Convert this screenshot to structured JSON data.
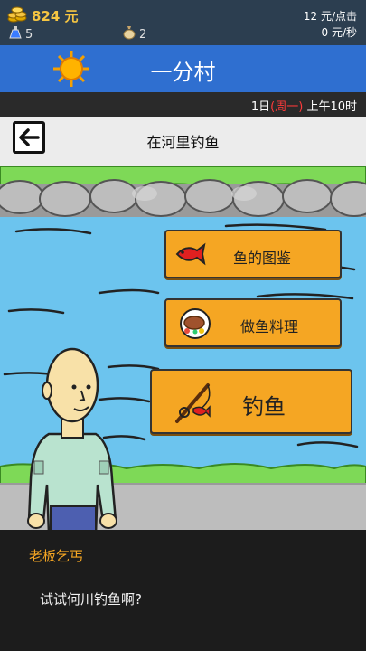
{
  "status": {
    "gold": "824 元",
    "potions": "5",
    "bags": "2",
    "per_click": "12 元/点击",
    "per_second": "0 元/秒"
  },
  "header": {
    "title": "一分村",
    "weather_icon": "sun-icon"
  },
  "date": {
    "day": "1日",
    "weekday": "(周一)",
    "time": "上午10时"
  },
  "scene": {
    "title": "在河里钓鱼",
    "back_icon": "back-arrow-icon"
  },
  "actions": {
    "fish_guide": "鱼的图鉴",
    "cook_fish": "做鱼料理",
    "go_fishing": "钓鱼"
  },
  "dialog": {
    "speaker": "老板乞丐",
    "text": "试试何川钓鱼啊?"
  },
  "colors": {
    "title_bar": "#2f6fd0",
    "button": "#f5a623",
    "water": "#6cc4ee",
    "grass": "#7ed957"
  }
}
